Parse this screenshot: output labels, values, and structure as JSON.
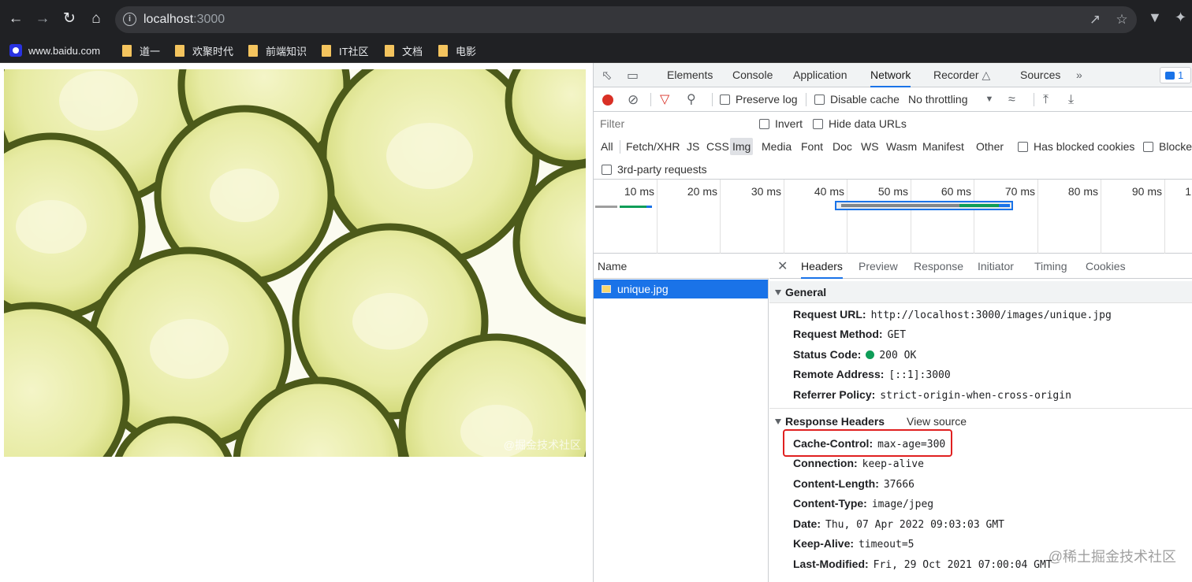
{
  "browser": {
    "url_host": "localhost",
    "url_port": ":3000",
    "bookmarks": [
      {
        "label": "www.baidu.com",
        "icon": "baidu-icon"
      },
      {
        "label": "道一",
        "icon": "folder-icon"
      },
      {
        "label": "欢聚时代",
        "icon": "folder-icon"
      },
      {
        "label": "前端知识",
        "icon": "folder-icon"
      },
      {
        "label": "IT社区",
        "icon": "folder-icon"
      },
      {
        "label": "文档",
        "icon": "folder-icon"
      },
      {
        "label": "电影",
        "icon": "folder-icon"
      }
    ]
  },
  "page": {
    "image_watermark": "@掘金技术社区"
  },
  "devtools": {
    "tabs": [
      "Elements",
      "Console",
      "Application",
      "Network",
      "Recorder",
      "Sources"
    ],
    "active_tab": "Network",
    "issues_count": "1",
    "toolbar": {
      "preserve_log": "Preserve log",
      "disable_cache": "Disable cache",
      "throttling": "No throttling"
    },
    "filter": {
      "placeholder": "Filter",
      "invert": "Invert",
      "hide_data_urls": "Hide data URLs",
      "types": [
        "All",
        "Fetch/XHR",
        "JS",
        "CSS",
        "Img",
        "Media",
        "Font",
        "Doc",
        "WS",
        "Wasm",
        "Manifest",
        "Other"
      ],
      "active_type": "Img",
      "has_blocked_cookies": "Has blocked cookies",
      "blocked_requests": "Blocked",
      "third_party": "3rd-party requests"
    },
    "overview_ticks": [
      "10 ms",
      "20 ms",
      "30 ms",
      "40 ms",
      "50 ms",
      "60 ms",
      "70 ms",
      "80 ms",
      "90 ms",
      "1"
    ],
    "requests": {
      "header": "Name",
      "items": [
        {
          "name": "unique.jpg"
        }
      ]
    },
    "details": {
      "tabs": [
        "Headers",
        "Preview",
        "Response",
        "Initiator",
        "Timing",
        "Cookies"
      ],
      "active_tab": "Headers",
      "general_title": "General",
      "general": [
        {
          "key": "Request URL:",
          "value": "http://localhost:3000/images/unique.jpg"
        },
        {
          "key": "Request Method:",
          "value": "GET"
        },
        {
          "key": "Status Code:",
          "value": "200 OK"
        },
        {
          "key": "Remote Address:",
          "value": "[::1]:3000"
        },
        {
          "key": "Referrer Policy:",
          "value": "strict-origin-when-cross-origin"
        }
      ],
      "response_title": "Response Headers",
      "view_source": "View source",
      "response": [
        {
          "key": "Cache-Control:",
          "value": "max-age=300"
        },
        {
          "key": "Connection:",
          "value": "keep-alive"
        },
        {
          "key": "Content-Length:",
          "value": "37666"
        },
        {
          "key": "Content-Type:",
          "value": "image/jpeg"
        },
        {
          "key": "Date:",
          "value": "Thu, 07 Apr 2022 09:03:03 GMT"
        },
        {
          "key": "Keep-Alive:",
          "value": "timeout=5"
        },
        {
          "key": "Last-Modified:",
          "value": "Fri, 29 Oct 2021 07:00:04 GMT"
        }
      ]
    }
  },
  "site_watermark": "@稀土掘金技术社区"
}
